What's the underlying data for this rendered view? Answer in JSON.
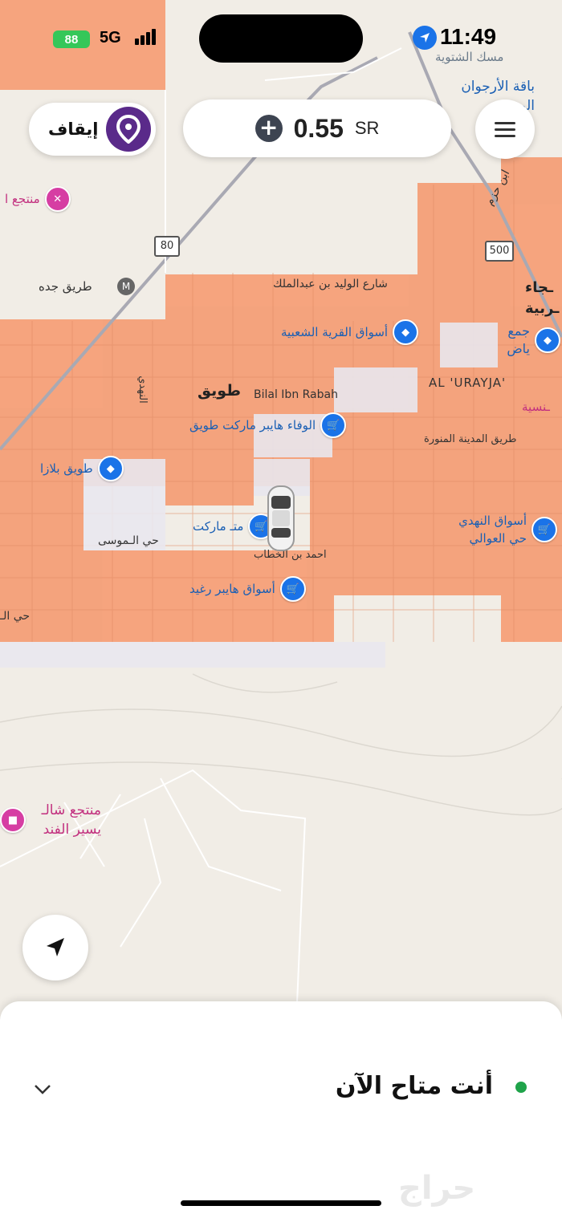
{
  "status_bar": {
    "battery": "88",
    "network": "5G",
    "time": "11:49"
  },
  "header": {
    "stop_label": "إيقاف",
    "balance_amount": "0.55",
    "balance_currency": "SR"
  },
  "map": {
    "road_numbers": [
      "80",
      "500"
    ],
    "places": [
      {
        "name": "طريق جده"
      },
      {
        "name": "شارع الوليد بن عبدالملك"
      },
      {
        "name": "أسواق القرية الشعبية"
      },
      {
        "name": "طويق"
      },
      {
        "name": "Bilal Ibn Rabah"
      },
      {
        "name": "الوفاء هايبر ماركت طويق"
      },
      {
        "name": "طويق بلازا"
      },
      {
        "name": "AL 'URAYJA'"
      },
      {
        "name": "طريق المدينة المنورة"
      },
      {
        "name": "متـ ماركت"
      },
      {
        "name": "حي الـموسى"
      },
      {
        "name": "احمد بن الخطاب"
      },
      {
        "name": "أسواق هايبر رغيد"
      },
      {
        "name": "أسواق النهدي حي العوالي"
      },
      {
        "name": "منتجع شالـ يسير الفند"
      },
      {
        "name": "منتجع ا"
      },
      {
        "name": "باقة الأرجوان الور"
      },
      {
        "name": "مسك الشتوية"
      },
      {
        "name": "ابن حزم"
      },
      {
        "name": "النهدي"
      },
      {
        "name": "حي الـ"
      },
      {
        "name": "ـنسية"
      },
      {
        "name": "ـجاء ـربية"
      },
      {
        "name": "جمع ياض"
      }
    ]
  },
  "sheet": {
    "status_text": "أنت متاح الآن"
  },
  "colors": {
    "zone": "#f5a078",
    "accent_purple": "#5a2a8a",
    "available_green": "#1fa34a"
  }
}
